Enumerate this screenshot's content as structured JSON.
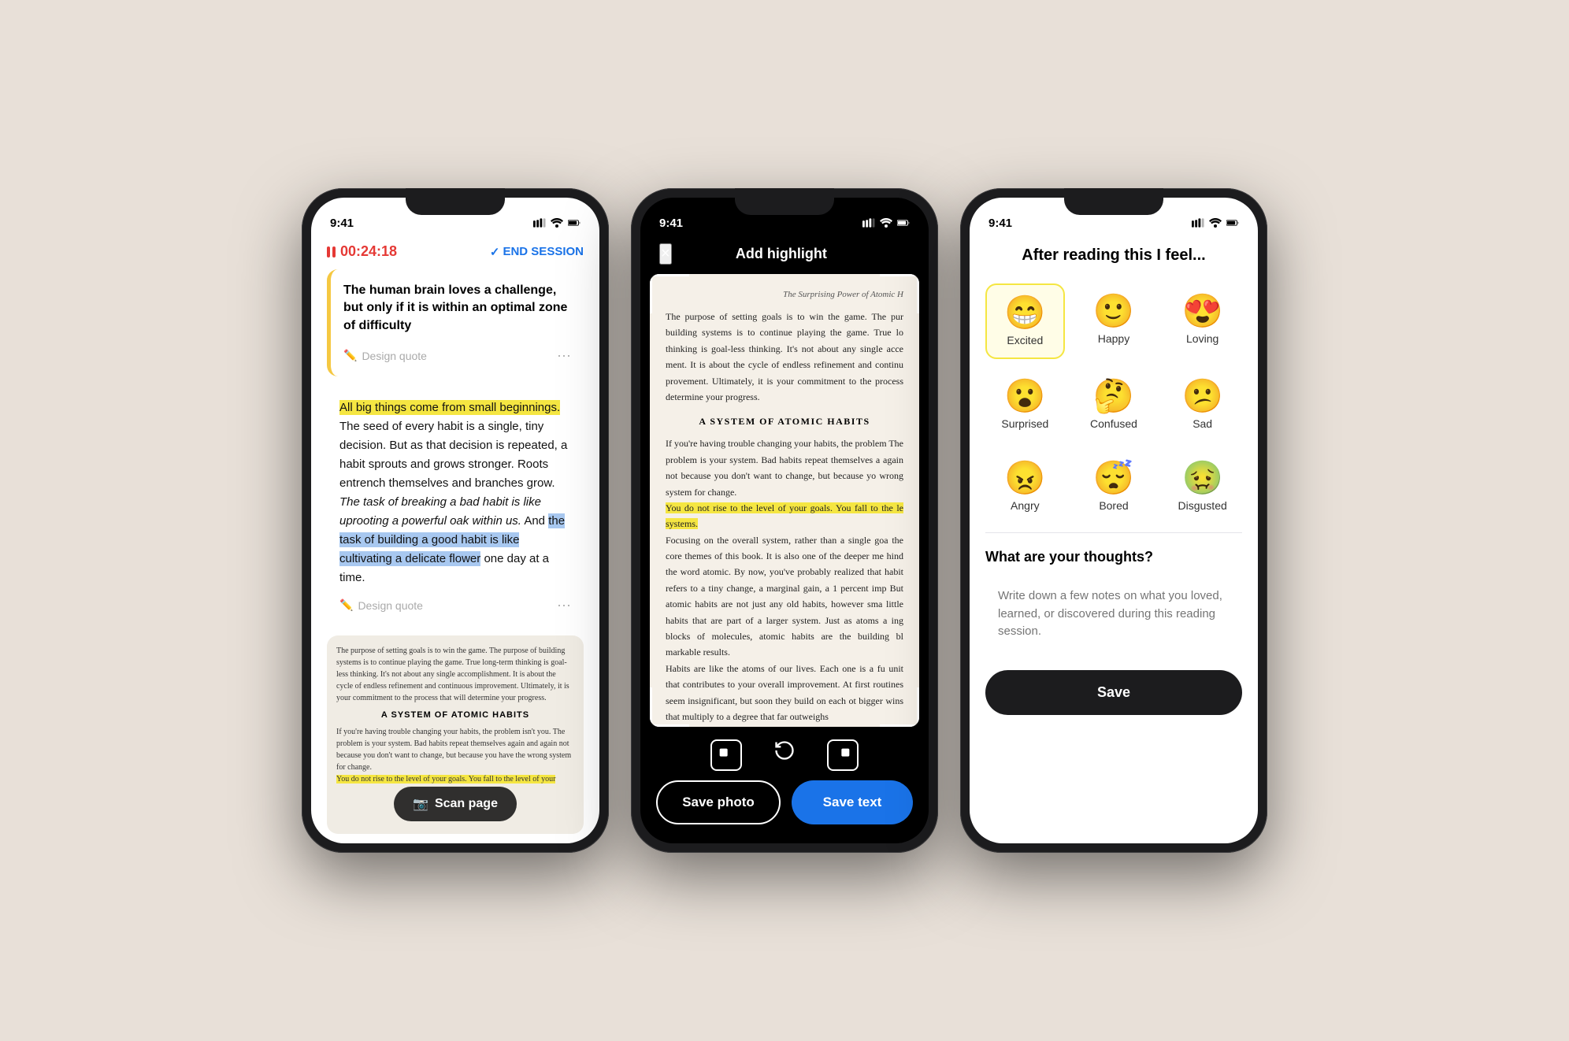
{
  "colors": {
    "accent_blue": "#1a73e8",
    "accent_red": "#e53935",
    "highlight_yellow": "#f5e642",
    "highlight_blue": "#a8c8f0",
    "dark": "#1c1c1e",
    "selected_bg": "#fffde7",
    "selected_border": "#f5e642"
  },
  "phone1": {
    "status_time": "9:41",
    "timer": "00:24:18",
    "end_session": "END SESSION",
    "quote1": {
      "text": "The human brain loves a challenge, but only if it is within an optimal zone of difficulty"
    },
    "design_quote": "Design quote",
    "text_block": {
      "highlighted_start": "All big things come from small beginnings.",
      "body": " The seed of every habit is a single, tiny decision. But as that decision is repeated, a habit sprouts and grows stronger. Roots entrench themselves and branches grow.",
      "italic": "The task of breaking a bad habit is like uprooting a powerful oak within us.",
      "and": " And ",
      "blue_highlight": "the task of building a good habit is like cultivating a delicate flower",
      "end": " one day at a time."
    },
    "design_quote2": "Design quote",
    "scan_preview": {
      "header": "The purpose of setting goals is to win the game. The purpose of building systems is to continue playing the game. True long-term thinking is goal-less thinking. It's not about any single accomplishment. It is about the cycle of endless refinement and continuous improvement. Ultimately, it is your commitment to the process that will determine your progress.",
      "section_title": "A SYSTEM OF ATOMIC HABITS",
      "body": "If you're having trouble changing your habits, the problem isn't you. The problem is your system. Bad habits repeat themselves again and again not because you don't want to change, but because you have the wrong system for change.",
      "highlight_text": "You do not rise to the level of your goals. You fall to the level of your"
    },
    "scan_btn": "Scan page"
  },
  "phone2": {
    "status_time": "9:41",
    "title": "Add highlight",
    "close": "×",
    "book_header": "The Surprising Power of Atomic H",
    "book_text1": "The purpose of setting goals is to win the game. The pur building systems is to continue playing the game. True lo thinking is goal-less thinking. It's not about any single acce ment. It is about the cycle of endless refinement and continu provement. Ultimately, it is your commitment to the process determine your progress.",
    "section_title": "A SYSTEM OF ATOMIC HABITS",
    "book_text2": "If you're having trouble changing your habits, the problem The problem is your system. Bad habits repeat themselves a again not because you don't want to change, but because yo wrong system for change.",
    "highlighted_text": "You do not rise to the level of your goals. You fall to the le systems.",
    "book_text3": "Focusing on the overall system, rather than a single goa the core themes of this book. It is also one of the deeper me hind the word atomic. By now, you've probably realized that habit refers to a tiny change, a marginal gain, a 1 percent imp But atomic habits are not just any old habits, however sma little habits that are part of a larger system. Just as atoms a ing blocks of molecules, atomic habits are the building bl markable results.",
    "book_text4": "Habits are like the atoms of our lives. Each one is a fu unit that contributes to your overall improvement. At first routines seem insignificant, but soon they build on each ot bigger wins that multiply to a degree that far outweighs",
    "save_photo": "Save photo",
    "save_text": "Save text"
  },
  "phone3": {
    "status_time": "9:41",
    "title": "After reading this I feel...",
    "emojis": [
      {
        "id": "excited",
        "emoji": "😁",
        "label": "Excited",
        "selected": true
      },
      {
        "id": "happy",
        "emoji": "🙂",
        "label": "Happy",
        "selected": false
      },
      {
        "id": "loving",
        "emoji": "😍",
        "label": "Loving",
        "selected": false
      },
      {
        "id": "surprised",
        "emoji": "😮",
        "label": "Surprised",
        "selected": false
      },
      {
        "id": "confused",
        "emoji": "🤔",
        "label": "Confused",
        "selected": false
      },
      {
        "id": "sad",
        "emoji": "😕",
        "label": "Sad",
        "selected": false
      },
      {
        "id": "angry",
        "emoji": "😠",
        "label": "Angry",
        "selected": false
      },
      {
        "id": "bored",
        "emoji": "😴",
        "label": "Bored",
        "selected": false
      },
      {
        "id": "disgusted",
        "emoji": "🤢",
        "label": "Disgusted",
        "selected": false
      }
    ],
    "thoughts_title": "What are your thoughts?",
    "thoughts_placeholder": "Write down a few notes on what you loved, learned, or discovered during this reading session.",
    "save_btn": "Save"
  }
}
